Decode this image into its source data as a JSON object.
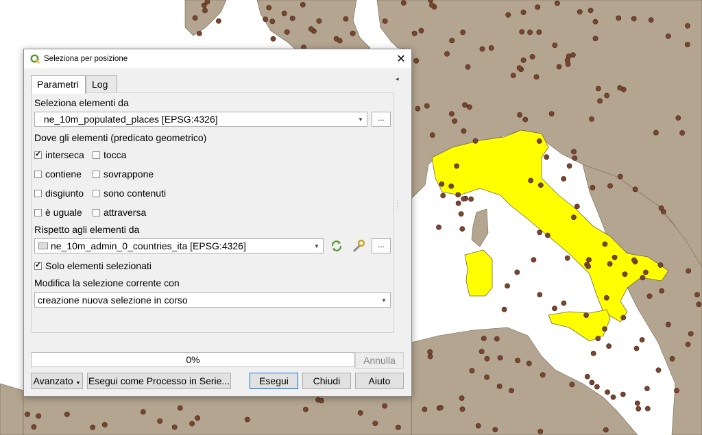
{
  "window": {
    "title": "Seleziona per posizione",
    "close_glyph": "✕",
    "collapse_glyph": "◂"
  },
  "tabs": [
    {
      "label": "Parametri",
      "active": true
    },
    {
      "label": "Log",
      "active": false
    }
  ],
  "params": {
    "select_from_label": "Seleziona elementi da",
    "select_from_value": "ne_10m_populated_places [EPSG:4326]",
    "predicate_label": "Dove gli elementi (predicato geometrico)",
    "predicates": [
      {
        "label": "interseca",
        "checked": true
      },
      {
        "label": "tocca",
        "checked": false
      },
      {
        "label": "contiene",
        "checked": false
      },
      {
        "label": "sovrappone",
        "checked": false
      },
      {
        "label": "disgiunto",
        "checked": false
      },
      {
        "label": "sono contenuti",
        "checked": false
      },
      {
        "label": "è uguale",
        "checked": false
      },
      {
        "label": "attraversa",
        "checked": false
      }
    ],
    "compare_label": "Rispetto agli elementi da",
    "compare_value": "ne_10m_admin_0_countries_ita [EPSG:4326]",
    "selected_only_label": "Solo elementi selezionati",
    "selected_only_checked": true,
    "modify_label": "Modifica la selezione corrente con",
    "modify_value": "creazione nuova selezione in corso",
    "ellipsis": "..."
  },
  "footer": {
    "progress_text": "0%",
    "progress_value": 0,
    "cancel_label": "Annulla",
    "advanced_label": "Avanzato",
    "batch_label": "Esegui come Processo in Serie...",
    "run_label": "Esegui",
    "close_label": "Chiudi",
    "help_label": "Aiuto"
  },
  "colors": {
    "land": "#b3a58f",
    "sea": "#ffffff",
    "highlight": "#ffff00",
    "point": "#7a4530",
    "qgis_green": "#589632"
  },
  "icons": {
    "logo": "qgis-logo-icon",
    "iterate": "iterate-icon",
    "wrench": "wrench-icon"
  }
}
